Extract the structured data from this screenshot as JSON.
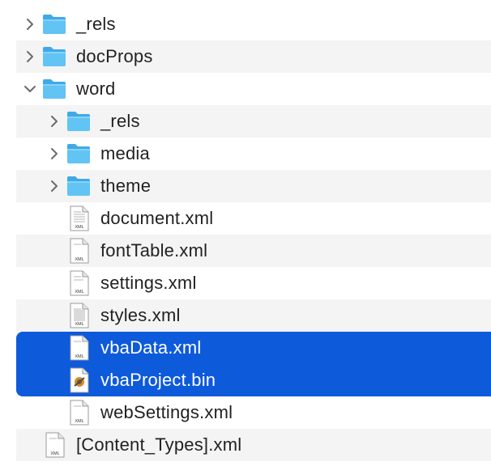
{
  "colors": {
    "selection": "#0d5adb",
    "folder_body": "#62c3f5",
    "folder_tab": "#3fa9e8",
    "stripe": "#f4f4f4",
    "text": "#222222",
    "chevron": "#6b6b6b"
  },
  "rows": [
    {
      "label": "_rels",
      "kind": "folder",
      "icon": "folder-icon",
      "expanded": false
    },
    {
      "label": "docProps",
      "kind": "folder",
      "icon": "folder-icon",
      "expanded": false
    },
    {
      "label": "word",
      "kind": "folder",
      "icon": "folder-icon",
      "expanded": true
    },
    {
      "label": "_rels",
      "kind": "folder",
      "icon": "folder-icon",
      "expanded": false
    },
    {
      "label": "media",
      "kind": "folder",
      "icon": "folder-icon",
      "expanded": false
    },
    {
      "label": "theme",
      "kind": "folder",
      "icon": "folder-icon",
      "expanded": false
    },
    {
      "label": "document.xml",
      "kind": "xml",
      "icon": "xml-file-icon",
      "badge": "XML"
    },
    {
      "label": "fontTable.xml",
      "kind": "xml",
      "icon": "xml-file-icon",
      "badge": "XML"
    },
    {
      "label": "settings.xml",
      "kind": "xml",
      "icon": "xml-file-icon",
      "badge": "XML"
    },
    {
      "label": "styles.xml",
      "kind": "xml",
      "icon": "xml-file-icon",
      "badge": "XML"
    },
    {
      "label": "vbaData.xml",
      "kind": "xml",
      "icon": "xml-file-icon",
      "badge": "XML",
      "selected": true
    },
    {
      "label": "vbaProject.bin",
      "kind": "bin",
      "icon": "binary-file-icon",
      "selected": true
    },
    {
      "label": "webSettings.xml",
      "kind": "xml",
      "icon": "xml-file-icon",
      "badge": "XML"
    },
    {
      "label": "[Content_Types].xml",
      "kind": "xml",
      "icon": "xml-file-icon",
      "badge": "XML"
    }
  ]
}
